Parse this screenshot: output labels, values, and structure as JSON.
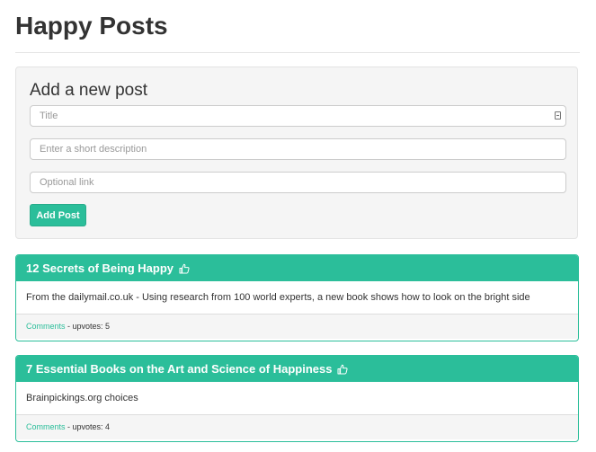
{
  "page": {
    "title": "Happy Posts"
  },
  "form": {
    "heading": "Add a new post",
    "title_placeholder": "Title",
    "description_placeholder": "Enter a short description",
    "link_placeholder": "Optional link",
    "submit_label": "Add Post"
  },
  "posts": [
    {
      "title": "12 Secrets of Being Happy",
      "description": "From the dailymail.co.uk - Using research from 100 world experts, a new book shows how to look on the bright side",
      "comments_label": "Comments",
      "upvotes_text": " - upvotes: 5"
    },
    {
      "title": "7 Essential Books on the Art and Science of Happiness",
      "description": "Brainpickings.org choices",
      "comments_label": "Comments",
      "upvotes_text": " - upvotes: 4"
    }
  ],
  "icons": {
    "upvote": "thumbs-up-icon",
    "autofill": "autofill-key-icon"
  },
  "colors": {
    "accent": "#2bbe9a",
    "well": "#f5f5f5",
    "text": "#333333"
  }
}
